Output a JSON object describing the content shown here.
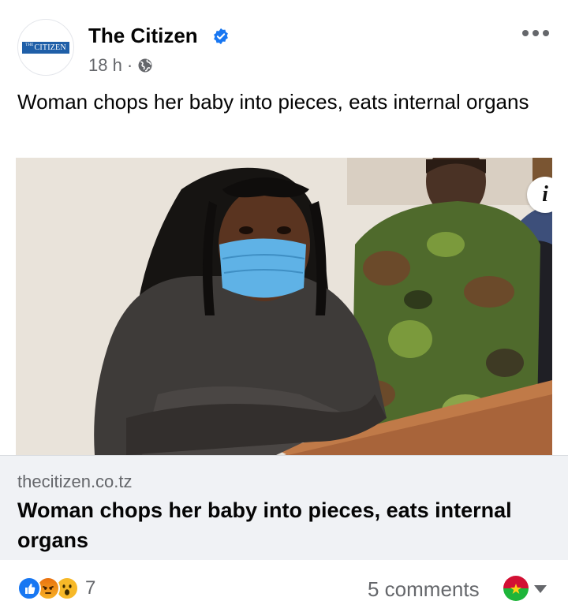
{
  "header": {
    "page_name": "The Citizen",
    "avatar_logo": "CITIZEN",
    "avatar_logo_prefix": "THE",
    "timestamp": "18 h",
    "separator": "·",
    "verified_color": "#1877f2"
  },
  "post": {
    "caption": "Woman chops her baby into pieces, eats internal organs"
  },
  "link_card": {
    "domain": "thecitizen.co.tz",
    "title": "Woman chops her baby into pieces, eats internal organs",
    "info_label": "i"
  },
  "footer": {
    "reaction_icons": [
      "like-icon",
      "angry-icon",
      "wow-icon"
    ],
    "reaction_count": "7",
    "comments": "5 comments"
  }
}
